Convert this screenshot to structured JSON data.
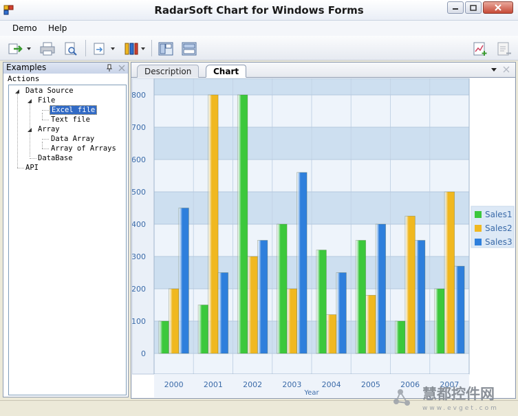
{
  "window": {
    "title": "RadarSoft Chart for Windows Forms"
  },
  "menu": {
    "items": [
      "Demo",
      "Help"
    ]
  },
  "left_panel": {
    "title": "Examples",
    "actions_label": "Actions",
    "tree": {
      "data_source": "Data Source",
      "file": "File",
      "excel_file": "Excel file",
      "text_file": "Text file",
      "array": "Array",
      "data_array": "Data Array",
      "array_of_arrays": "Array of Arrays",
      "database": "DataBase",
      "api": "API"
    }
  },
  "tabs": {
    "description": "Description",
    "chart": "Chart"
  },
  "watermark": {
    "chinese": "慧都控件网",
    "url": "www.evget.com"
  },
  "chart_data": {
    "type": "bar",
    "categories": [
      "2000",
      "2001",
      "2002",
      "2003",
      "2004",
      "2005",
      "2006",
      "2007"
    ],
    "series": [
      {
        "name": "Sales1",
        "color": "#3cc83c",
        "values": [
          100,
          150,
          800,
          400,
          320,
          350,
          100,
          200
        ]
      },
      {
        "name": "Sales2",
        "color": "#f0b820",
        "values": [
          200,
          800,
          300,
          200,
          120,
          180,
          425,
          500
        ]
      },
      {
        "name": "Sales3",
        "color": "#2e7fdc",
        "values": [
          450,
          250,
          350,
          560,
          250,
          400,
          350,
          270
        ]
      }
    ],
    "xlabel": "Year",
    "ylabel": "",
    "ylim": [
      0,
      800
    ],
    "yticks": [
      "0",
      "100",
      "200",
      "300",
      "400",
      "500",
      "600",
      "700",
      "800"
    ],
    "legend_position": "right",
    "grid": true
  }
}
